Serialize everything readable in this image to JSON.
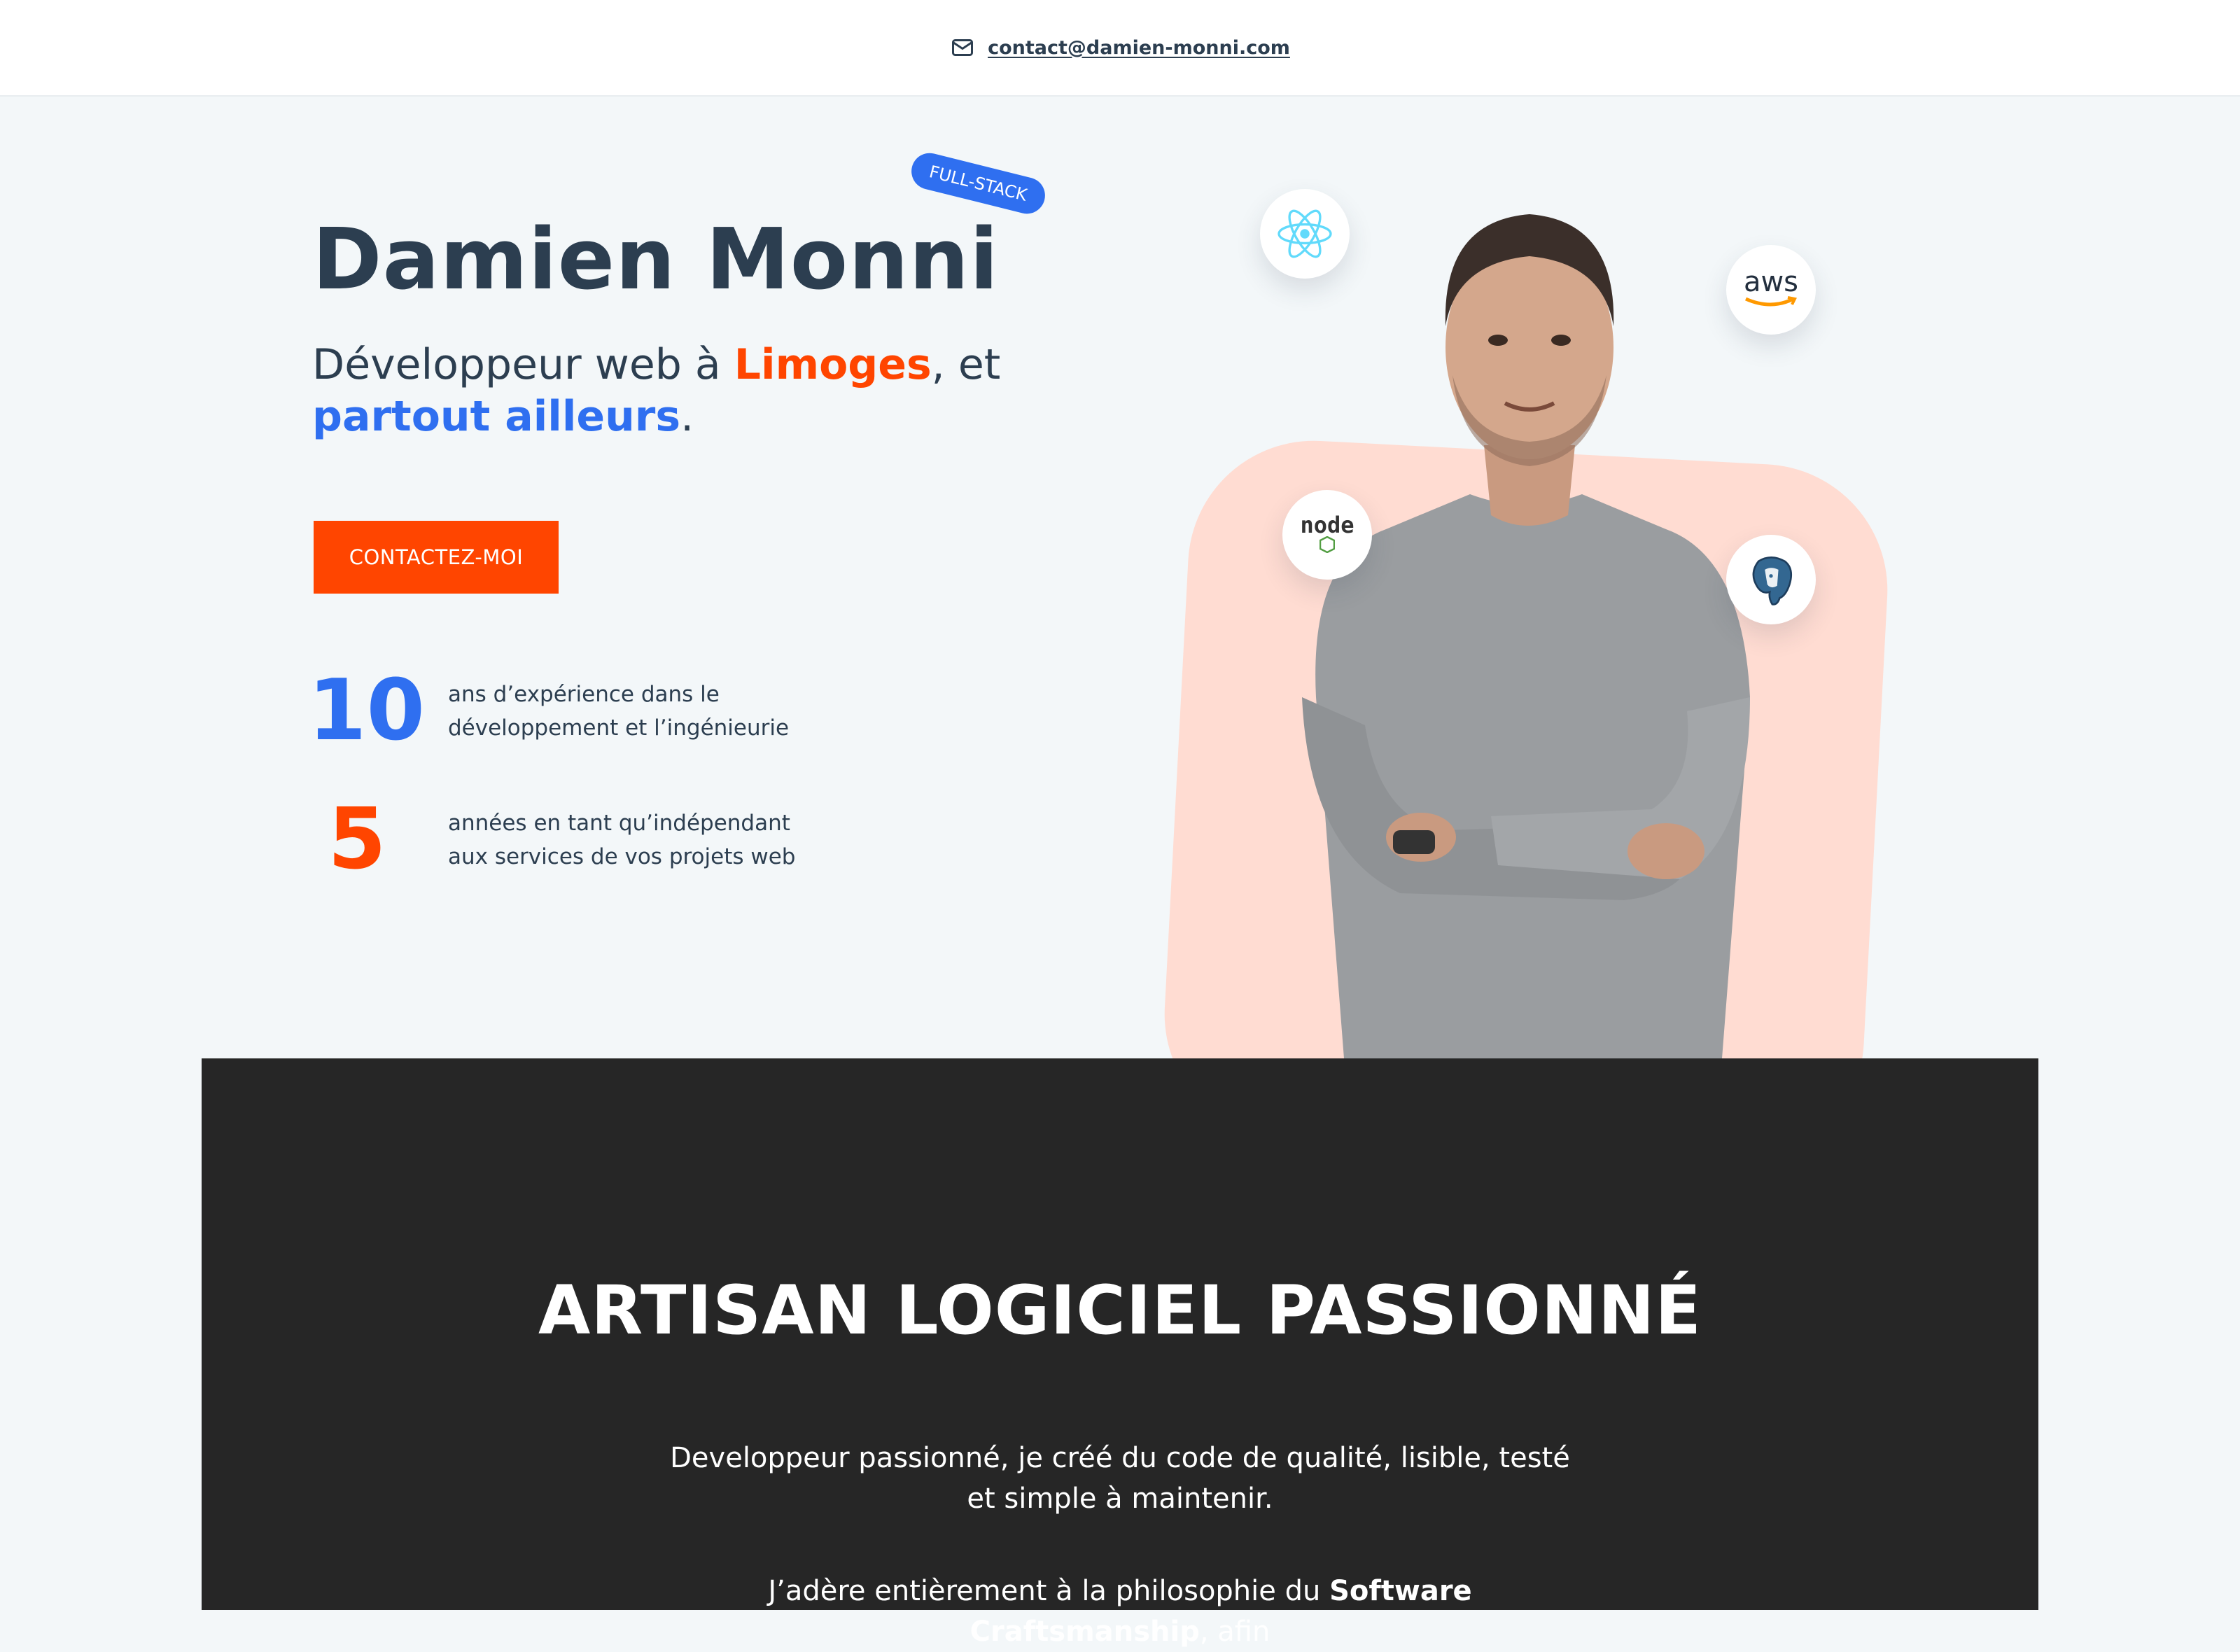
{
  "topbar": {
    "email": "contact@damien-monni.com",
    "icon": "mail-icon"
  },
  "hero": {
    "name": "Damien Monni",
    "badge": "FULL-STACK",
    "subtitle": {
      "part1": "Développeur web à ",
      "city": "Limoges",
      "part2": ", et",
      "elsewhere": "partout ailleurs",
      "end": "."
    },
    "cta_label": "CONTACTEZ-MOI",
    "stats": [
      {
        "number": "10",
        "line1": "ans d’expérience dans le",
        "line2": "développement et l’ingénieurie"
      },
      {
        "number": "5",
        "line1": "années en tant qu’indépendant",
        "line2": "aux services de vos projets web"
      }
    ],
    "tech_icons": [
      "react-icon",
      "aws-icon",
      "node-icon",
      "postgresql-icon"
    ],
    "aws_text": "aws",
    "node_text": "node"
  },
  "about": {
    "title": "ARTISAN LOGICIEL PASSIONNÉ",
    "p1": "Developpeur passionné, je créé du code de qualité, lisible, testé et simple à maintenir.",
    "p2_start": "J’adère entièrement à la philosophie du ",
    "p2_bold": "Software Craftsmanship",
    "p2_end": ", afin"
  },
  "colors": {
    "accent_orange": "#ff4500",
    "accent_blue": "#2f6ff0",
    "dark": "#262626",
    "text": "#2c3e50"
  }
}
